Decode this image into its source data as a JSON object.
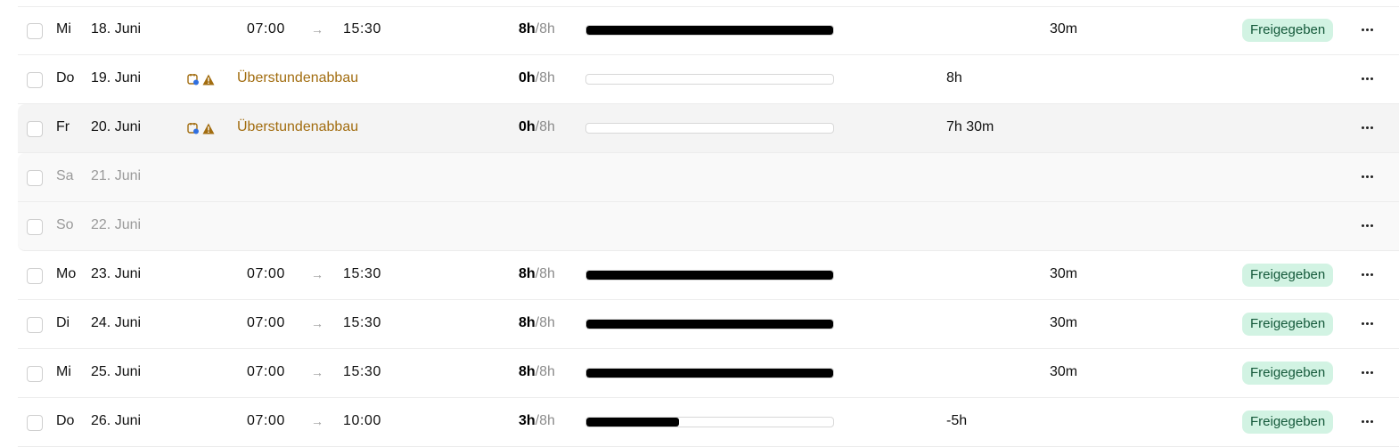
{
  "colors": {
    "reason_text": "#a26d10",
    "badge_bg": "#d2f3e3",
    "badge_text": "#14593a",
    "bar_fill": "#000000",
    "calendar_icon_dot": "#2f6fe0",
    "warning_icon": "#a26d10"
  },
  "icons": {
    "calendar": "calendar-icon",
    "warning": "warning-icon",
    "arrow": "arrow-right-icon",
    "more": "more-horizontal-icon"
  },
  "rows": [
    {
      "day": "Mi",
      "date": "18. Juni",
      "start": "07:00",
      "arrow": "→",
      "end": "15:30",
      "worked": "8h",
      "target": "/8h",
      "progress": 1.0,
      "diff": "",
      "pause": "30m",
      "status": "Freigegeben",
      "reason": "",
      "weekend": false
    },
    {
      "day": "Do",
      "date": "19. Juni",
      "start": "",
      "arrow": "",
      "end": "",
      "worked": "0h",
      "target": "/8h",
      "progress": 0.0,
      "diff": "8h",
      "pause": "",
      "status": "",
      "reason": "Überstundenabbau",
      "weekend": false
    },
    {
      "day": "Fr",
      "date": "20. Juni",
      "start": "",
      "arrow": "",
      "end": "",
      "worked": "0h",
      "target": "/8h",
      "progress": 0.0,
      "diff": "7h 30m",
      "pause": "",
      "status": "",
      "reason": "Überstundenabbau",
      "weekend": false
    },
    {
      "day": "Sa",
      "date": "21. Juni",
      "start": "",
      "arrow": "",
      "end": "",
      "worked": "",
      "target": "",
      "progress": null,
      "diff": "",
      "pause": "",
      "status": "",
      "reason": "",
      "weekend": true
    },
    {
      "day": "So",
      "date": "22. Juni",
      "start": "",
      "arrow": "",
      "end": "",
      "worked": "",
      "target": "",
      "progress": null,
      "diff": "",
      "pause": "",
      "status": "",
      "reason": "",
      "weekend": true
    },
    {
      "day": "Mo",
      "date": "23. Juni",
      "start": "07:00",
      "arrow": "→",
      "end": "15:30",
      "worked": "8h",
      "target": "/8h",
      "progress": 1.0,
      "diff": "",
      "pause": "30m",
      "status": "Freigegeben",
      "reason": "",
      "weekend": false
    },
    {
      "day": "Di",
      "date": "24. Juni",
      "start": "07:00",
      "arrow": "→",
      "end": "15:30",
      "worked": "8h",
      "target": "/8h",
      "progress": 1.0,
      "diff": "",
      "pause": "30m",
      "status": "Freigegeben",
      "reason": "",
      "weekend": false
    },
    {
      "day": "Mi",
      "date": "25. Juni",
      "start": "07:00",
      "arrow": "→",
      "end": "15:30",
      "worked": "8h",
      "target": "/8h",
      "progress": 1.0,
      "diff": "",
      "pause": "30m",
      "status": "Freigegeben",
      "reason": "",
      "weekend": false
    },
    {
      "day": "Do",
      "date": "26. Juni",
      "start": "07:00",
      "arrow": "→",
      "end": "10:00",
      "worked": "3h",
      "target": "/8h",
      "progress": 0.375,
      "diff": "-5h",
      "pause": "",
      "status": "Freigegeben",
      "reason": "",
      "weekend": false
    }
  ]
}
